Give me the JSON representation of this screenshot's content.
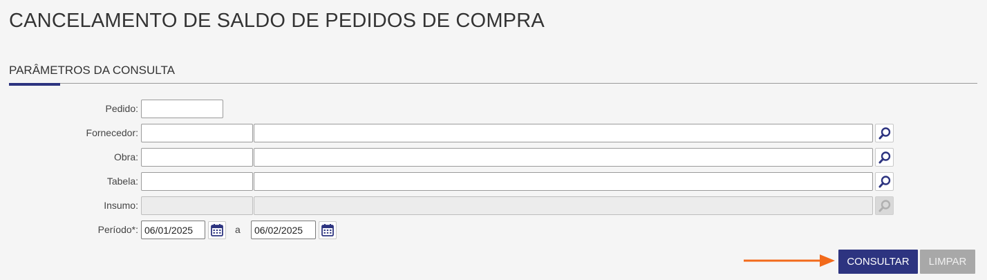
{
  "page": {
    "title": "CANCELAMENTO DE SALDO DE PEDIDOS DE COMPRA"
  },
  "section": {
    "title": "PARÂMETROS DA CONSULTA"
  },
  "form": {
    "pedido": {
      "label": "Pedido:",
      "value": ""
    },
    "fornecedor": {
      "label": "Fornecedor:",
      "code": "",
      "name": ""
    },
    "obra": {
      "label": "Obra:",
      "code": "",
      "name": ""
    },
    "tabela": {
      "label": "Tabela:",
      "code": "",
      "name": ""
    },
    "insumo": {
      "label": "Insumo:",
      "code": "",
      "name": "",
      "disabled": true
    },
    "periodo": {
      "label": "Período*:",
      "start": "06/01/2025",
      "separator": "a",
      "end": "06/02/2025"
    }
  },
  "actions": {
    "consultar_label": "CONSULTAR",
    "limpar_label": "LIMPAR"
  },
  "icons": {
    "search": "search-icon",
    "calendar": "calendar-icon",
    "annotation": "arrow-right-icon"
  },
  "colors": {
    "primary": "#2d3480",
    "secondary_button": "#a8a8a8",
    "annotation_arrow": "#f26a1b",
    "background": "#f5f5f5"
  }
}
